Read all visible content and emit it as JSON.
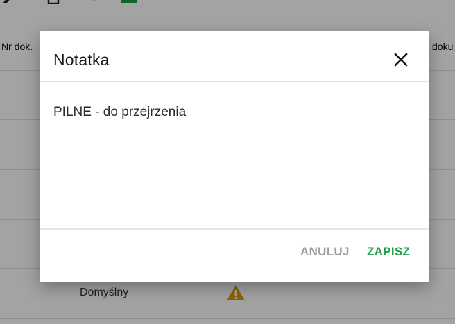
{
  "background": {
    "table_header": {
      "col_nr": "Nr dok.",
      "col_right": "i doku"
    },
    "rows": [
      {
        "type": ""
      },
      {
        "type": ""
      },
      {
        "type": ""
      },
      {
        "type": ""
      },
      {
        "type": "Domyślny",
        "warning": true
      }
    ]
  },
  "dialog": {
    "title": "Notatka",
    "note_value": "PILNE - do przejrzenia",
    "cancel_label": "ANULUJ",
    "save_label": "ZAPISZ"
  },
  "colors": {
    "save": "#1e9e4a",
    "cancel": "#9e9e9e",
    "warning": "#e09b00",
    "overlay": "rgba(0,0,0,0.36)"
  }
}
